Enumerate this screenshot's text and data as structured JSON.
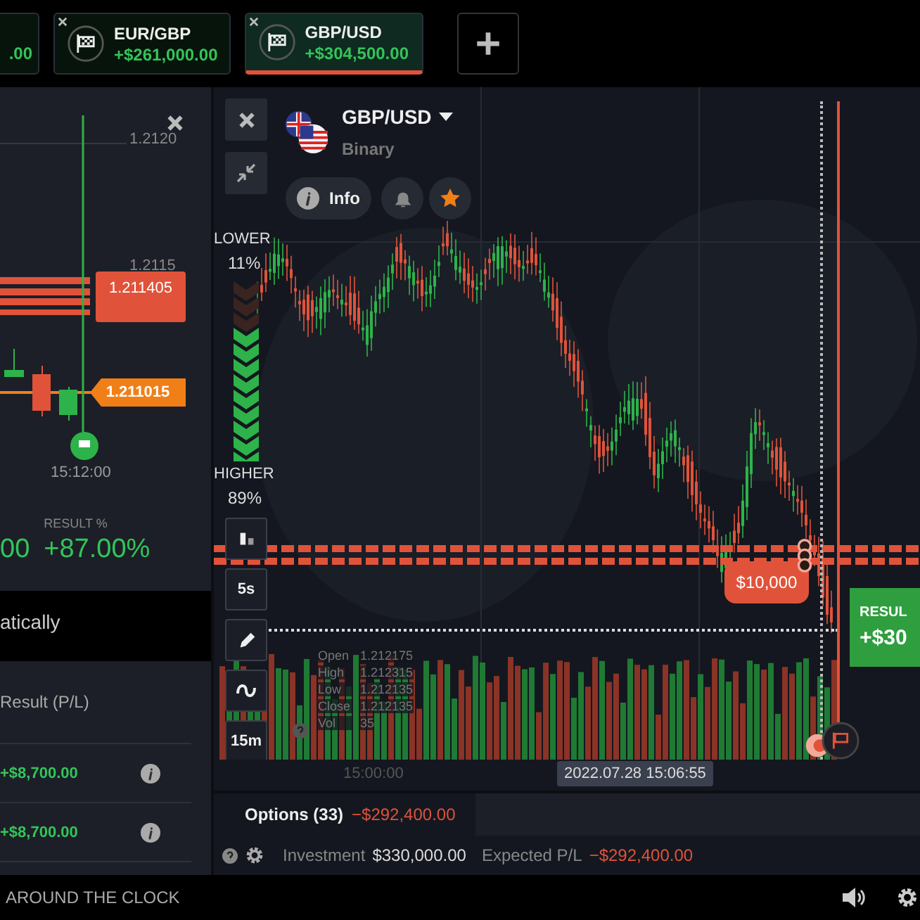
{
  "tabs": [
    {
      "amount": ".00",
      "selected": false
    },
    {
      "label": "EUR/GBP",
      "amount": "+$261,000.00",
      "selected": false
    },
    {
      "label": "GBP/USD",
      "amount": "+$304,500.00",
      "selected": true
    }
  ],
  "left_panel": {
    "axis_labels": [
      "1.2120",
      "1.2115"
    ],
    "sell_tag": "1.211405",
    "current_tag": "1.211015",
    "expiry_time": "15:12:00",
    "amount_partial": "00",
    "result_label": "RESULT %",
    "result_value": "+87.00%",
    "notice": "atically",
    "table": {
      "header": "Result (P/L)",
      "rows": [
        "+$8,700.00",
        "+$8,700.00"
      ]
    }
  },
  "main_panel": {
    "asset": "GBP/USD",
    "asset_type": "Binary",
    "info_label": "Info",
    "favorite": true,
    "lower": {
      "label": "LOWER",
      "percent": "11%"
    },
    "higher": {
      "label": "HIGHER",
      "percent": "89%"
    },
    "tools": [
      {
        "kind": "chart-type"
      },
      {
        "kind": "text",
        "label": "5s"
      },
      {
        "kind": "pencil"
      },
      {
        "kind": "wave"
      },
      {
        "kind": "text",
        "label": "15m"
      }
    ],
    "ohlc": [
      {
        "label": "Open",
        "value": "1.212175"
      },
      {
        "label": "High",
        "value": "1.212315"
      },
      {
        "label": "Low",
        "value": "1.212135"
      },
      {
        "label": "Close",
        "value": "1.212135"
      },
      {
        "label": "Vol",
        "value": "35"
      }
    ],
    "trade_tag": "$10,000",
    "result": {
      "label": "RESUL",
      "value": "+$30"
    },
    "time_label": "15:00:00",
    "crosshair_time": "2022.07.28 15:06:55"
  },
  "options_bar": {
    "label": "Options (33)",
    "total": "−$292,400.00"
  },
  "stats": {
    "investment_label": "Investment",
    "investment": "$330,000.00",
    "expected_label": "Expected P/L",
    "expected": "−$292,400.00"
  },
  "status_bar": {
    "text": "AROUND THE CLOCK"
  }
}
